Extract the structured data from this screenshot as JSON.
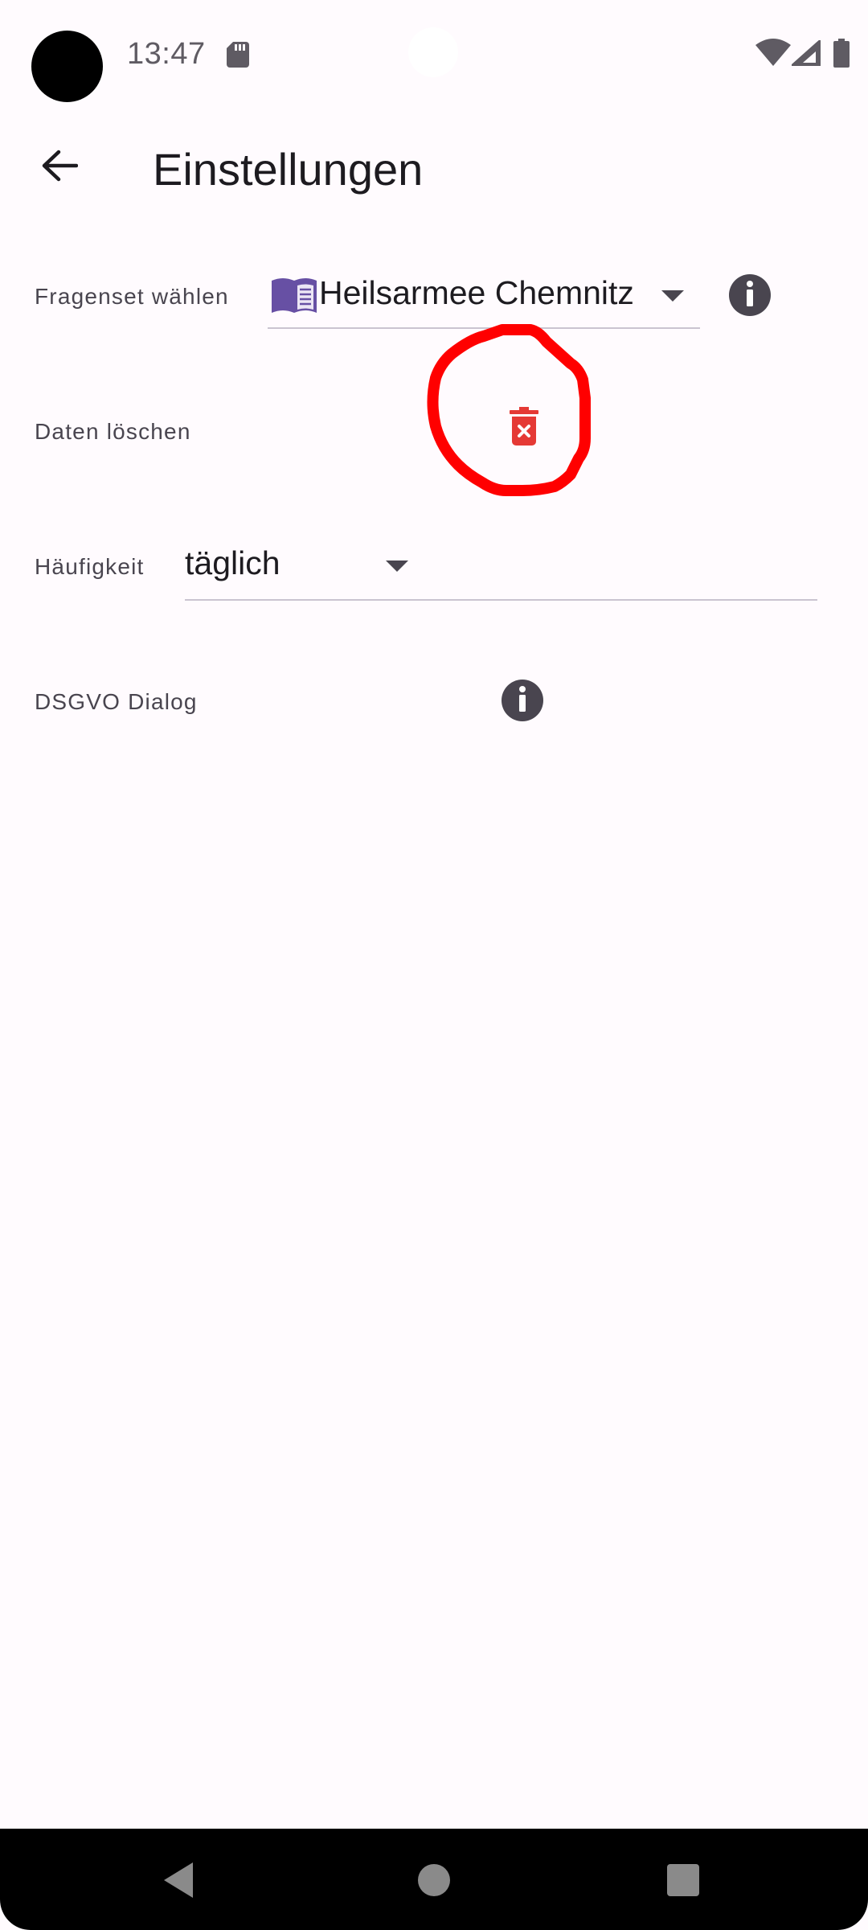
{
  "status_bar": {
    "time": "13:47",
    "icons": [
      "sd-card-icon",
      "wifi-icon",
      "cell-signal-icon",
      "battery-icon"
    ]
  },
  "app_bar": {
    "back_icon": "arrow-back-icon",
    "title": "Einstellungen"
  },
  "settings": {
    "question_set": {
      "label": "Fragenset wählen",
      "icon": "book-icon",
      "value": "Heilsarmee Chemnitz"
    },
    "delete_data": {
      "label": "Daten löschen",
      "icon": "delete-forever-icon"
    },
    "frequency": {
      "label": "Häufigkeit",
      "value": "täglich"
    },
    "gdpr": {
      "label": "DSGVO Dialog",
      "icon": "info-icon"
    }
  },
  "colors": {
    "background": "#fffbfe",
    "delete": "#e53935",
    "book": "#6750a4",
    "annotation": "#ff0000",
    "info_bg": "#49454f"
  },
  "nav_bar": {
    "icons": [
      "nav-back-icon",
      "nav-home-icon",
      "nav-recents-icon"
    ]
  }
}
